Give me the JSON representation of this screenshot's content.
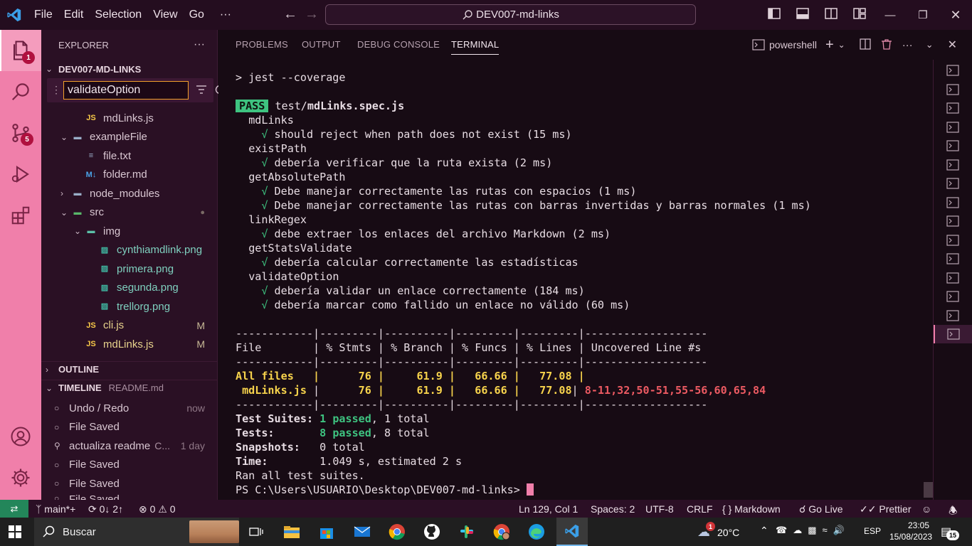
{
  "titlebar": {
    "menu": [
      "File",
      "Edit",
      "Selection",
      "View",
      "Go"
    ],
    "more": "···",
    "command_center": "DEV007-md-links"
  },
  "activity": {
    "explorer_badge": "1",
    "scm_badge": "5"
  },
  "sidebar": {
    "explorer_title": "EXPLORER",
    "explorer_more": "···",
    "workspace": "DEV007-MD-LINKS",
    "filter_value": "validateOption",
    "tree": [
      {
        "label": "mdLinks.js",
        "icon": "JS",
        "indent": 2,
        "type": "js",
        "mod": ""
      },
      {
        "label": "exampleFile",
        "icon": "folder",
        "indent": 1,
        "type": "folder-open",
        "mod": ""
      },
      {
        "label": "file.txt",
        "icon": "txt",
        "indent": 2,
        "type": "txt",
        "mod": ""
      },
      {
        "label": "folder.md",
        "icon": "M↓",
        "indent": 2,
        "type": "md",
        "mod": ""
      },
      {
        "label": "node_modules",
        "icon": "folder",
        "indent": 1,
        "type": "folder",
        "mod": ""
      },
      {
        "label": "src",
        "icon": "folder",
        "indent": 1,
        "type": "folder-open",
        "mod": "●"
      },
      {
        "label": "img",
        "icon": "folder",
        "indent": 2,
        "type": "folder-open",
        "mod": ""
      },
      {
        "label": "cynthiamdlink.png",
        "icon": "img",
        "indent": 3,
        "type": "img",
        "mod": ""
      },
      {
        "label": "primera.png",
        "icon": "img",
        "indent": 3,
        "type": "img",
        "mod": ""
      },
      {
        "label": "segunda.png",
        "icon": "img",
        "indent": 3,
        "type": "img",
        "mod": ""
      },
      {
        "label": "trellorg.png",
        "icon": "img",
        "indent": 3,
        "type": "img",
        "mod": ""
      },
      {
        "label": "cli.js",
        "icon": "JS",
        "indent": 2,
        "type": "js",
        "mod": "M"
      },
      {
        "label": "mdLinks.js",
        "icon": "JS",
        "indent": 2,
        "type": "js",
        "mod": "M"
      }
    ],
    "outline_title": "OUTLINE",
    "timeline_title": "TIMELINE",
    "timeline_file": "README.md",
    "timeline": [
      {
        "label": "Undo / Redo",
        "time": "now"
      },
      {
        "label": "File Saved",
        "time": ""
      },
      {
        "label": "actualiza readme",
        "extra": "C...",
        "time": "1 day"
      },
      {
        "label": "File Saved",
        "time": ""
      },
      {
        "label": "File Saved",
        "time": ""
      },
      {
        "label": "File Saved",
        "time": ""
      }
    ]
  },
  "panel": {
    "tabs": [
      "PROBLEMS",
      "OUTPUT",
      "DEBUG CONSOLE",
      "TERMINAL"
    ],
    "active_tab": "TERMINAL",
    "shell_name": "powershell",
    "shell_more": "···"
  },
  "terminal": {
    "command": "> jest --coverage",
    "pass_badge": "PASS",
    "test_dir": "test/",
    "test_file": "mdLinks.spec.js",
    "groups": [
      {
        "name": "mdLinks",
        "tests": [
          "√ should reject when path does not exist (15 ms)"
        ]
      },
      {
        "name": "existPath",
        "tests": [
          "√ debería verificar que la ruta exista (2 ms)"
        ]
      },
      {
        "name": "getAbsolutePath",
        "tests": [
          "√ Debe manejar correctamente las rutas con espacios (1 ms)",
          "√ Debe manejar correctamente las rutas con barras invertidas y barras normales (1 ms)"
        ]
      },
      {
        "name": "linkRegex",
        "tests": [
          "√ debe extraer los enlaces del archivo Markdown (2 ms)"
        ]
      },
      {
        "name": "getStatsValidate",
        "tests": [
          "√ debería calcular correctamente las estadísticas"
        ]
      },
      {
        "name": "validateOption",
        "tests": [
          "√ debería validar un enlace correctamente (184 ms)",
          "√ debería marcar como fallido un enlace no válido (60 ms)"
        ]
      }
    ],
    "table": {
      "sep": "------------|---------|----------|---------|---------|-------------------",
      "header": "File        | % Stmts | % Branch | % Funcs | % Lines | Uncovered Line #s",
      "allfiles": "All files   |      76 |     61.9 |   66.66 |   77.08 |",
      "row_name": " mdLinks.js ",
      "row_cols": "|      76 |     61.9 |   66.66 |   77.08 | ",
      "row_uncovered": "8-11,32,50-51,55-56,60,65,84"
    },
    "summary": {
      "suites_label": "Test Suites:",
      "suites_passed": "1 passed",
      "suites_total": ", 1 total",
      "tests_label": "Tests:",
      "tests_passed": "8 passed",
      "tests_total": ", 8 total",
      "snap_label": "Snapshots:",
      "snap_value": "0 total",
      "time_label": "Time:",
      "time_value": "1.049 s, estimated 2 s",
      "ran": "Ran all test suites."
    },
    "prompt": "PS C:\\Users\\USUARIO\\Desktop\\DEV007-md-links> "
  },
  "status": {
    "branch": "main*+",
    "sync": "0↓ 2↑",
    "errors": "0",
    "warnings": "0",
    "position": "Ln 129, Col 1",
    "spaces": "Spaces: 2",
    "encoding": "UTF-8",
    "eol": "CRLF",
    "language": "Markdown",
    "golive": "Go Live",
    "prettier": "Prettier"
  },
  "taskbar": {
    "search": "Buscar",
    "weather": "20°C",
    "lang": "ESP",
    "time": "23:05",
    "date": "15/08/2023",
    "notif_count": "15",
    "weather_badge": "1"
  }
}
